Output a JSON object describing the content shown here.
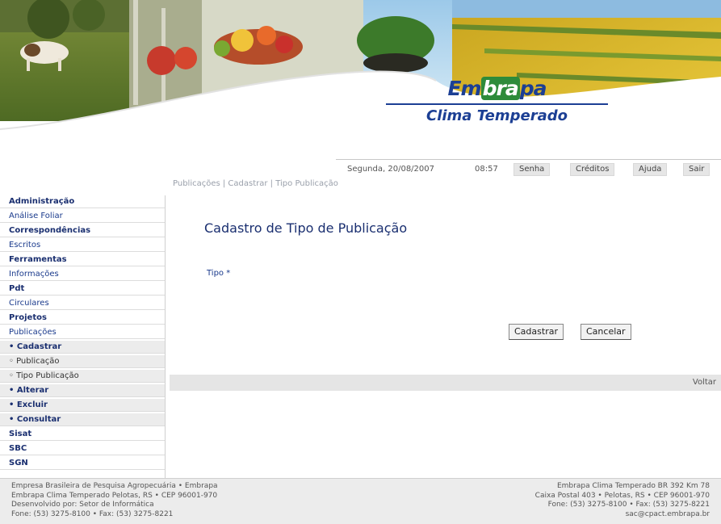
{
  "brand": {
    "word_prefix": "Em",
    "word_mid": "bra",
    "word_suffix": "pa",
    "subtitle": "Clima Temperado",
    "colors": {
      "primary": "#1c3f94",
      "accent": "#2e8b3a"
    }
  },
  "topbar": {
    "date": "Segunda, 20/08/2007",
    "time": "08:57",
    "menu": [
      "Senha",
      "Créditos",
      "Ajuda",
      "Sair"
    ]
  },
  "breadcrumb": "Publicações | Cadastrar | Tipo Publicação",
  "sidebar": {
    "items": [
      {
        "label": "Administração",
        "style": "bold"
      },
      {
        "label": "Análise Foliar",
        "style": "normal"
      },
      {
        "label": "Correspondências",
        "style": "bold"
      },
      {
        "label": "Escritos",
        "style": "normal"
      },
      {
        "label": "Ferramentas",
        "style": "bold"
      },
      {
        "label": "Informações",
        "style": "normal"
      },
      {
        "label": "Pdt",
        "style": "bold"
      },
      {
        "label": "Circulares",
        "style": "normal"
      },
      {
        "label": "Projetos",
        "style": "bold"
      },
      {
        "label": "Publicações",
        "style": "normal"
      },
      {
        "label": "• Cadastrar",
        "style": "subbold"
      },
      {
        "label": "◦ Publicação",
        "style": "sub"
      },
      {
        "label": "◦ Tipo Publicação",
        "style": "sub"
      },
      {
        "label": "• Alterar",
        "style": "subbold"
      },
      {
        "label": "• Excluir",
        "style": "subbold"
      },
      {
        "label": "• Consultar",
        "style": "subbold"
      },
      {
        "label": "Sisat",
        "style": "bold"
      },
      {
        "label": "SBC",
        "style": "bold"
      },
      {
        "label": "SGN",
        "style": "bold"
      }
    ]
  },
  "main": {
    "title": "Cadastro de Tipo de Publicação",
    "field_label": "Tipo *",
    "save_label": "Cadastrar",
    "cancel_label": "Cancelar",
    "strip_text": "Voltar"
  },
  "footer": {
    "left": [
      "Empresa Brasileira de Pesquisa Agropecuária • Embrapa",
      "Embrapa Clima Temperado Pelotas, RS • CEP 96001-970",
      "Desenvolvido por: Setor de Informática",
      "Fone: (53) 3275-8100 • Fax: (53) 3275-8221"
    ],
    "right": [
      "Embrapa Clima Temperado BR 392 Km 78",
      "Caixa Postal 403 • Pelotas, RS • CEP 96001-970",
      "Fone: (53) 3275-8100 • Fax: (53) 3275-8221",
      "sac@cpact.embrapa.br"
    ]
  }
}
